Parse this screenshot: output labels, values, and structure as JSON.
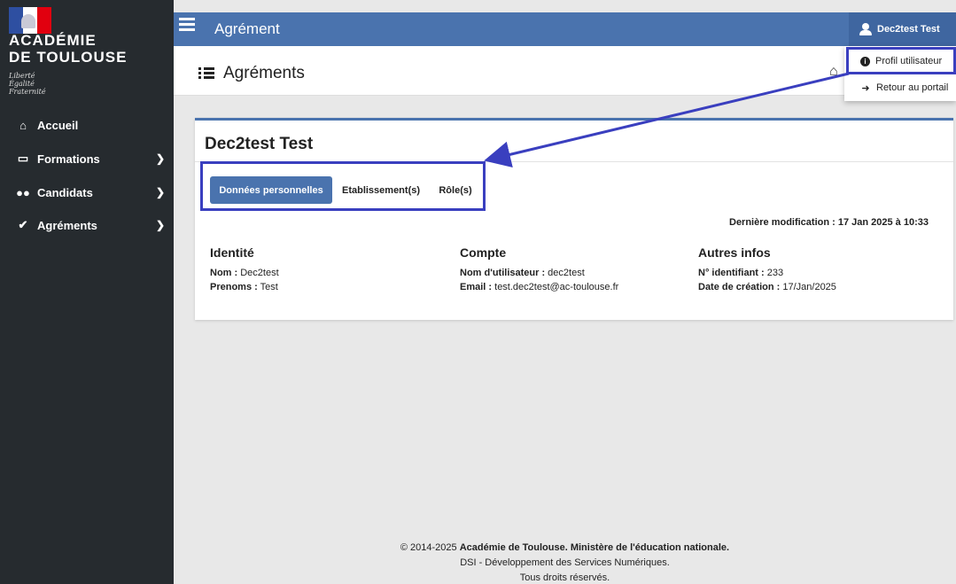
{
  "logo": {
    "line1": "ACADÉMIE",
    "line2": "DE TOULOUSE",
    "motto": [
      "Liberté",
      "Égalité",
      "Fraternité"
    ]
  },
  "sidebar": {
    "items": [
      {
        "label": "Accueil",
        "icon": "home-icon",
        "glyph": "🏠",
        "has_submenu": false
      },
      {
        "label": "Formations",
        "icon": "chalkboard-icon",
        "glyph": "▭",
        "has_submenu": true
      },
      {
        "label": "Candidats",
        "icon": "users-icon",
        "glyph": "👥",
        "has_submenu": true
      },
      {
        "label": "Agréments",
        "icon": "check-badge-icon",
        "glyph": "✔",
        "has_submenu": true
      }
    ]
  },
  "topbar": {
    "title": "Agrément",
    "user": "Dec2test Test"
  },
  "header": {
    "title": "Agréments"
  },
  "dropdown": {
    "items": [
      {
        "label": "Profil utilisateur",
        "icon": "info-icon"
      },
      {
        "label": "Retour au portail",
        "icon": "sign-out-icon"
      }
    ]
  },
  "card": {
    "title": "Dec2test Test",
    "tabs": [
      "Données personnelles",
      "Etablissement(s)",
      "Rôle(s)"
    ],
    "active_tab": "Données personnelles",
    "last_modified": "Dernière modification : 17 Jan 2025 à 10:33",
    "columns": [
      {
        "title": "Identité",
        "rows": [
          {
            "key": "Nom :",
            "value": " Dec2test"
          },
          {
            "key": "Prenoms :",
            "value": " Test"
          }
        ]
      },
      {
        "title": "Compte",
        "rows": [
          {
            "key": "Nom d'utilisateur :",
            "value": " dec2test"
          },
          {
            "key": "Email :",
            "value": " test.dec2test@ac-toulouse.fr"
          }
        ]
      },
      {
        "title": "Autres infos",
        "rows": [
          {
            "key": "N° identifiant :",
            "value": " 233"
          },
          {
            "key": "Date de création :",
            "value": " 17/Jan/2025"
          }
        ]
      }
    ]
  },
  "footer": {
    "copyright_prefix": "© 2014-2025 ",
    "copyright_bold": "Académie de Toulouse. Ministère de l'éducation nationale.",
    "line2": "DSI - Développement des Services Numériques.",
    "line3": "Tous droits réservés."
  },
  "colors": {
    "brand_blue": "#4a73ae",
    "sidebar_bg": "#262b2f",
    "highlight": "#3a3fbf"
  }
}
